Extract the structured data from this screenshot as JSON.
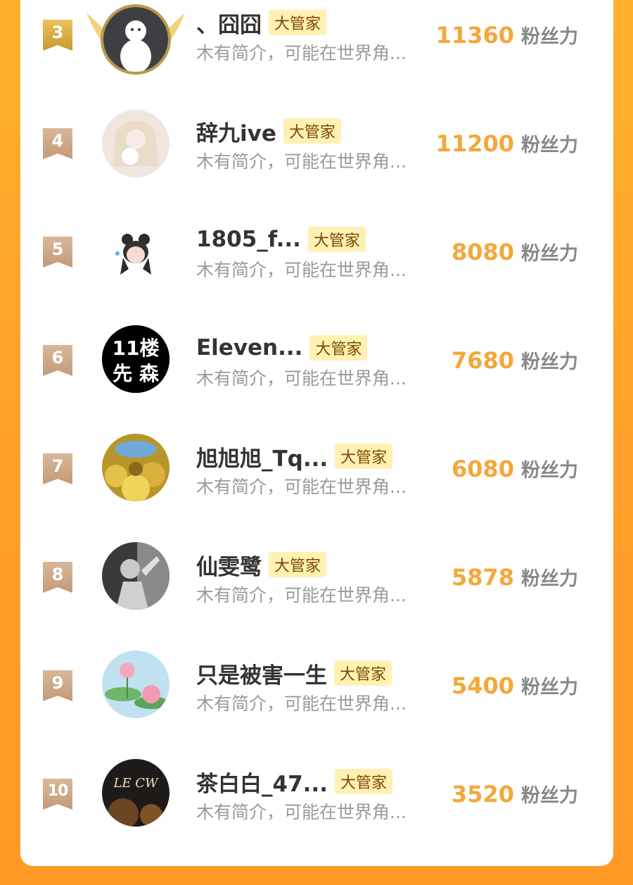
{
  "ranking": {
    "badge_label": "大管家",
    "desc_text": "木有简介，可能在世界角...",
    "unit_label": "粉丝力",
    "items": [
      {
        "rank": "3",
        "name": "、囧囧",
        "score": "11360"
      },
      {
        "rank": "4",
        "name": "辞九ive",
        "score": "11200"
      },
      {
        "rank": "5",
        "name": "1805_f...",
        "score": "8080"
      },
      {
        "rank": "6",
        "name": "Eleven...",
        "score": "7680"
      },
      {
        "rank": "7",
        "name": "旭旭旭_Tq...",
        "score": "6080"
      },
      {
        "rank": "8",
        "name": "仙雯鹭",
        "score": "5878"
      },
      {
        "rank": "9",
        "name": "只是被害一生",
        "score": "5400"
      },
      {
        "rank": "10",
        "name": "茶白白_47...",
        "score": "3520"
      }
    ],
    "avatar_texts": {
      "eleven_line1": "11楼",
      "eleven_line2": "先 森",
      "lecw": "LE CW"
    }
  },
  "colors": {
    "background": "#ffa12a",
    "score": "#f4a73a",
    "badge_bg": "#fff1b3",
    "rank_gold": "#d4a93e",
    "rank_tan": "#c9a282"
  }
}
